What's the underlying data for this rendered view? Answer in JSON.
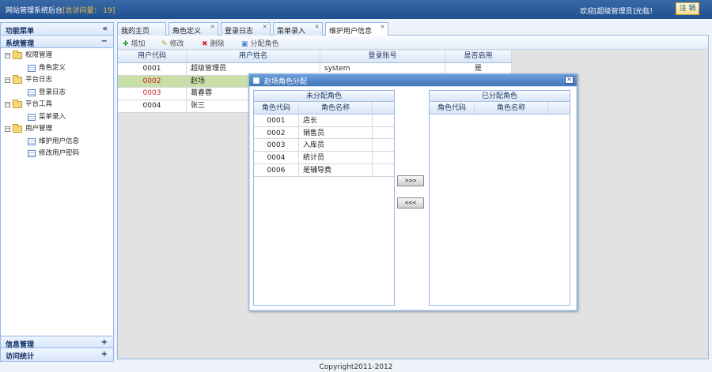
{
  "header": {
    "app_title": "网站管理系统后台",
    "visit_count": "[总访问量： 19]",
    "welcome": "欢迎[超级管理员]光临！",
    "logout": "注 销"
  },
  "sidebar": {
    "title": "功能菜单",
    "collapse": "«",
    "section": {
      "title": "系统管理",
      "toggle": "−"
    },
    "groups": [
      {
        "label": "权限管理",
        "toggle": "⊟",
        "items": [
          "角色定义"
        ]
      },
      {
        "label": "平台日志",
        "toggle": "⊟",
        "items": [
          "登录日志"
        ]
      },
      {
        "label": "平台工具",
        "toggle": "⊟",
        "items": [
          "菜单录入"
        ]
      },
      {
        "label": "用户管理",
        "toggle": "⊟",
        "items": [
          "维护用户信息",
          "修改用户密码"
        ]
      }
    ],
    "bottom": [
      {
        "title": "信息管理",
        "toggle": "+"
      },
      {
        "title": "访问统计",
        "toggle": "+"
      }
    ]
  },
  "tabs": [
    {
      "label": "我的主页"
    },
    {
      "label": "角色定义",
      "close": "×"
    },
    {
      "label": "登录日志",
      "close": "×"
    },
    {
      "label": "菜单录入",
      "close": "×"
    },
    {
      "label": "维护用户信息",
      "close": "×"
    }
  ],
  "toolbar": {
    "add": "增加",
    "edit": "修改",
    "delete": "删除",
    "assign": "分配角色"
  },
  "grid": {
    "columns": [
      "用户代码",
      "用户姓名",
      "登录账号",
      "是否启用"
    ],
    "rows": [
      {
        "code": "0001",
        "name": "超级管理员",
        "account": "system",
        "enabled": "是"
      },
      {
        "code": "0002",
        "name": "赵场"
      },
      {
        "code": "0003",
        "name": "葛春蓉"
      },
      {
        "code": "0004",
        "name": "张三"
      }
    ]
  },
  "dialog": {
    "title": "赵场角色分配",
    "close": "✕",
    "left": {
      "title": "未分配角色",
      "columns": [
        "角色代码",
        "角色名称"
      ],
      "rows": [
        {
          "code": "0001",
          "name": "店长"
        },
        {
          "code": "0002",
          "name": "销售员"
        },
        {
          "code": "0003",
          "name": "入库员"
        },
        {
          "code": "0004",
          "name": "统计员"
        },
        {
          "code": "0006",
          "name": "是辅导费"
        }
      ]
    },
    "right": {
      "title": "已分配角色",
      "columns": [
        "角色代码",
        "角色名称"
      ],
      "rows": []
    },
    "move_right": ">>>",
    "move_left": "<<<"
  },
  "footer": {
    "copyright": "Copyright2011-2012"
  }
}
